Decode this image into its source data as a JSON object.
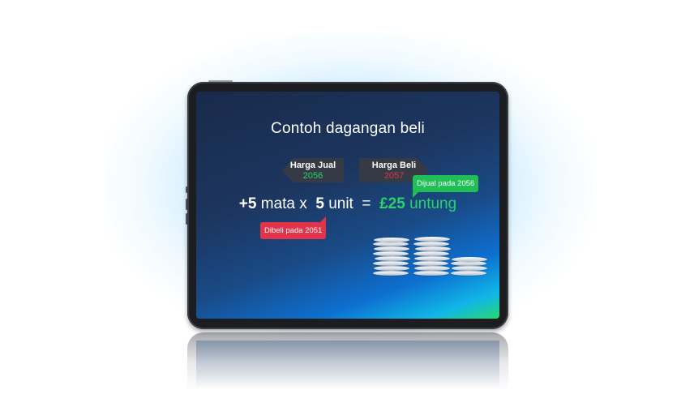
{
  "screen": {
    "title": "Contoh dagangan beli",
    "sell_tag": {
      "label": "Harga Jual",
      "value": "2056"
    },
    "buy_tag": {
      "label": "Harga Beli",
      "value": "2057"
    },
    "sold_bubble": "Dijual pada 2056",
    "bought_bubble": "Dibeli pada 2051",
    "equation": {
      "pips": "+5",
      "pips_word": "mata x",
      "units": "5",
      "units_word": "unit",
      "equals": "=",
      "profit": "£25",
      "profit_word": "untung"
    }
  },
  "colors": {
    "sell_value": "#27d36b",
    "buy_value": "#e1334a",
    "profit": "#27d36b",
    "bubble_green": "#1fbf55",
    "bubble_red": "#e1334a"
  },
  "icons": [
    "coin-stacks-icon"
  ]
}
